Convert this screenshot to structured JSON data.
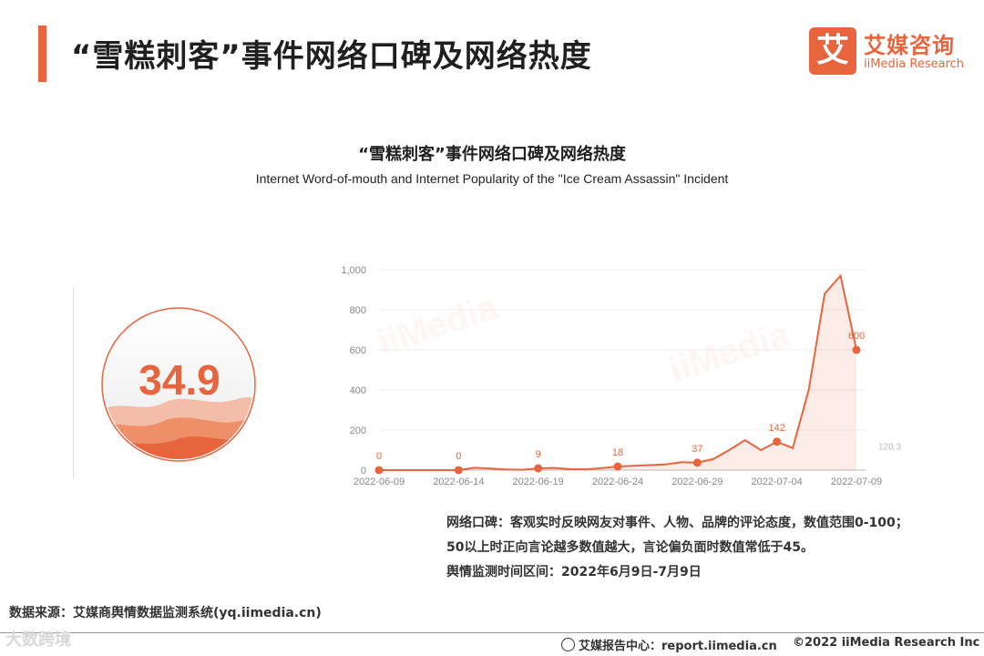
{
  "header": {
    "title": "“雪糕刺客”事件网络口碑及网络热度",
    "logo_mark": "艾",
    "logo_cn": "艾媒咨询",
    "logo_en": "iiMedia Research",
    "accent_color": "#e8643d"
  },
  "chart_title_cn": "“雪糕刺客”事件网络口碑及网络热度",
  "chart_title_en": "Internet Word-of-mouth and Internet Popularity of the  \"Ice Cream Assassin\"  Incident",
  "gauge": {
    "value": "34.9",
    "color": "#e8643d"
  },
  "chart_data": [
    {
      "type": "gauge",
      "value": 34.9,
      "range": [
        0,
        100
      ]
    },
    {
      "type": "area",
      "x_ticks": [
        "2022-06-09",
        "2022-06-14",
        "2022-06-19",
        "2022-06-24",
        "2022-06-29",
        "2022-07-04",
        "2022-07-09"
      ],
      "y_ticks": [
        "0",
        "200",
        "400",
        "600",
        "800",
        "1,000"
      ],
      "ylim": [
        0,
        1000
      ],
      "grid": true,
      "color": "#e8643d",
      "series": [
        {
          "x": [
            "2022-06-09",
            "2022-06-10",
            "2022-06-11",
            "2022-06-12",
            "2022-06-13",
            "2022-06-14",
            "2022-06-15",
            "2022-06-16",
            "2022-06-17",
            "2022-06-18",
            "2022-06-19",
            "2022-06-20",
            "2022-06-21",
            "2022-06-22",
            "2022-06-23",
            "2022-06-24",
            "2022-06-25",
            "2022-06-26",
            "2022-06-27",
            "2022-06-28",
            "2022-06-29",
            "2022-06-30",
            "2022-07-01",
            "2022-07-02",
            "2022-07-03",
            "2022-07-04",
            "2022-07-05",
            "2022-07-06",
            "2022-07-07",
            "2022-07-08",
            "2022-07-09"
          ],
          "values": [
            0,
            0,
            0,
            0,
            0,
            0,
            12,
            8,
            3,
            2,
            9,
            11,
            5,
            4,
            10,
            18,
            22,
            25,
            28,
            40,
            37,
            55,
            100,
            150,
            100,
            142,
            110,
            400,
            880,
            970,
            600
          ]
        }
      ],
      "data_labels": [
        {
          "x": "2022-06-09",
          "label": "0"
        },
        {
          "x": "2022-06-14",
          "label": "0"
        },
        {
          "x": "2022-06-19",
          "label": "9"
        },
        {
          "x": "2022-06-24",
          "label": "18"
        },
        {
          "x": "2022-06-29",
          "label": "37"
        },
        {
          "x": "2022-07-04",
          "label": "142"
        },
        {
          "x": "2022-07-09",
          "label": "600"
        }
      ],
      "side_label": "120.3"
    }
  ],
  "notes": {
    "line1": "网络口碑：客观实时反映网友对事件、人物、品牌的评论态度，数值范围0-100；",
    "line2": "50以上时正向言论越多数值越大，言论偏负面时数值常低于45。",
    "line3": "舆情监测时间区间：2022年6月9日-7月9日"
  },
  "source": "数据来源：艾媒商舆情数据监测系统(yq.iimedia.cn)",
  "footer": {
    "report": "艾媒报告中心：report.iimedia.cn",
    "copyright": "©2022  iiMedia Research  Inc",
    "watermark": "大数跨境"
  }
}
